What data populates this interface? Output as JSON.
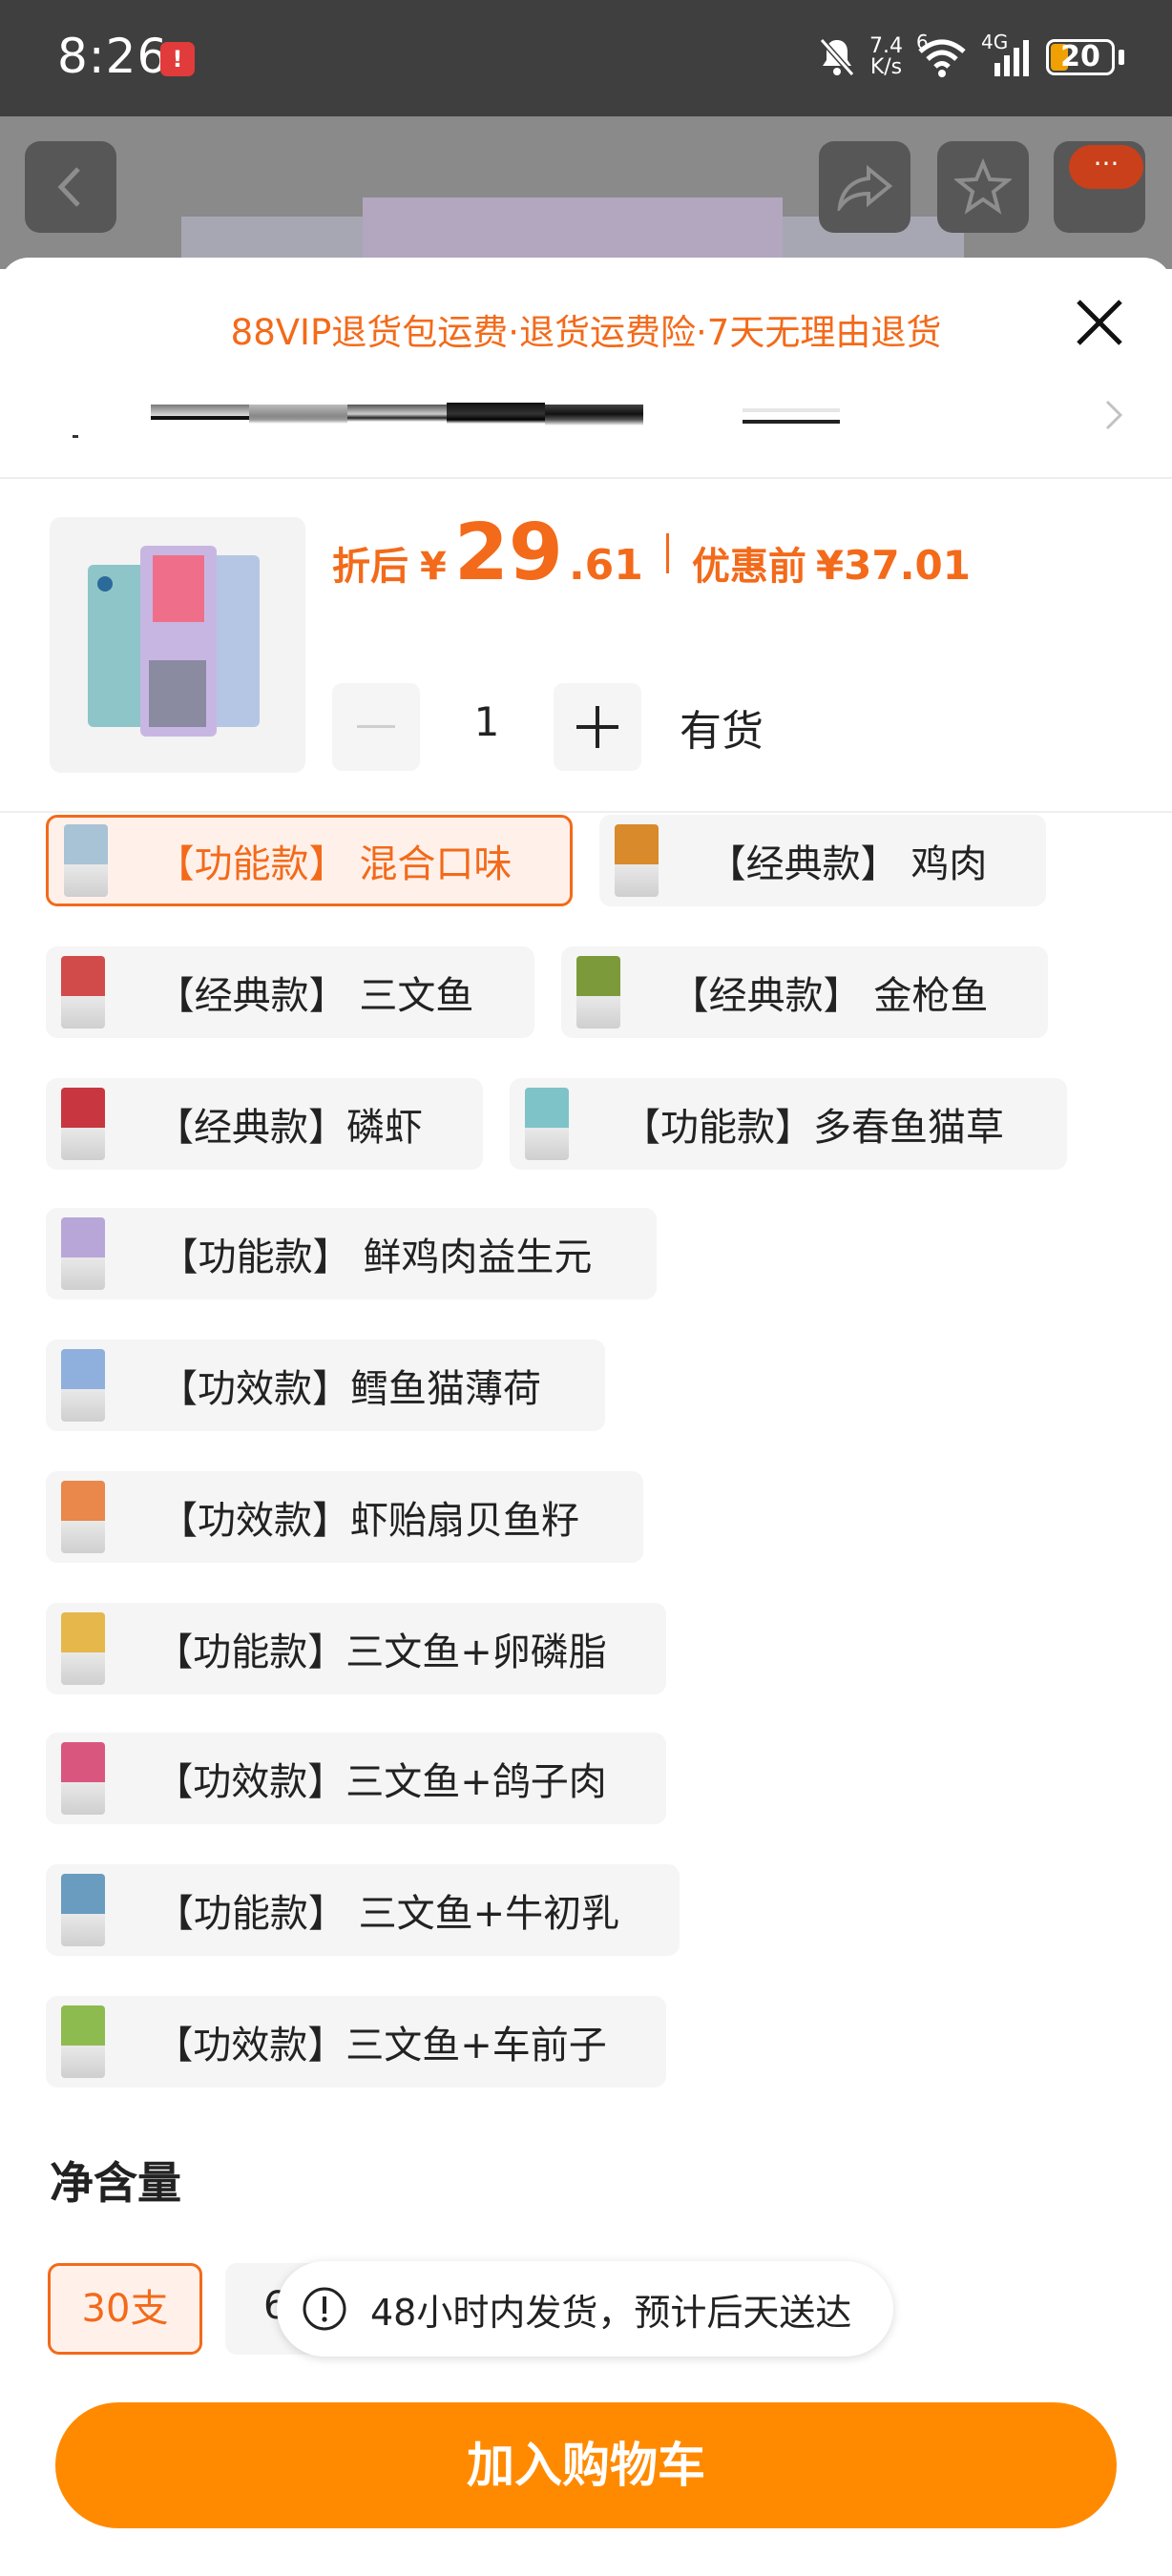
{
  "status_bar": {
    "time": "8:26",
    "alert_badge": "!",
    "net_speed_value": "7.4",
    "net_speed_unit": "K/s",
    "wifi_label": "6",
    "cell_label": "4G",
    "battery": "20",
    "battery_color": "#f0a000"
  },
  "background_page": {
    "more_label": "···"
  },
  "sheet": {
    "banner": "88VIP退货包运费·退货运费险·7天无理由退货",
    "price_label": "折后",
    "currency": "¥",
    "price_int": "29",
    "price_dec": ".61",
    "pre_label": "优惠前",
    "pre_price": "¥37.01",
    "quantity": "1",
    "stock": "有货"
  },
  "options": [
    {
      "label": "【功能款】 混合口味",
      "selected": true,
      "color": "#a8c3d6"
    },
    {
      "label": "【经典款】 鸡肉",
      "selected": false,
      "color": "#d98a2a"
    },
    {
      "label": "【经典款】 三文鱼",
      "selected": false,
      "color": "#d24b4b"
    },
    {
      "label": "【经典款】 金枪鱼",
      "selected": false,
      "color": "#7c9a3a"
    },
    {
      "label": "【经典款】磷虾",
      "selected": false,
      "color": "#c8373f"
    },
    {
      "label": "【功能款】多春鱼猫草",
      "selected": false,
      "color": "#7ec3c8"
    },
    {
      "label": "【功能款】 鲜鸡肉益生元",
      "selected": false,
      "color": "#b9a6d8"
    },
    {
      "label": "【功效款】鳕鱼猫薄荷",
      "selected": false,
      "color": "#8fb0dc"
    },
    {
      "label": "【功效款】虾贻扇贝鱼籽",
      "selected": false,
      "color": "#e9884a"
    },
    {
      "label": "【功能款】三文鱼+卵磷脂",
      "selected": false,
      "color": "#e6b74a"
    },
    {
      "label": "【功效款】三文鱼+鸽子肉",
      "selected": false,
      "color": "#d9577f"
    },
    {
      "label": "【功能款】 三文鱼+牛初乳",
      "selected": false,
      "color": "#6a9cc0"
    },
    {
      "label": "【功效款】三文鱼+车前子",
      "selected": false,
      "color": "#8dbb4f"
    }
  ],
  "net_content": {
    "title": "净含量",
    "options": [
      "30支",
      "6"
    ]
  },
  "toast": {
    "text": "48小时内发货，预计后天送达"
  },
  "cart_button": "加入购物车",
  "colors": {
    "accent": "#f36a1a",
    "cart": "#ff8a00"
  }
}
